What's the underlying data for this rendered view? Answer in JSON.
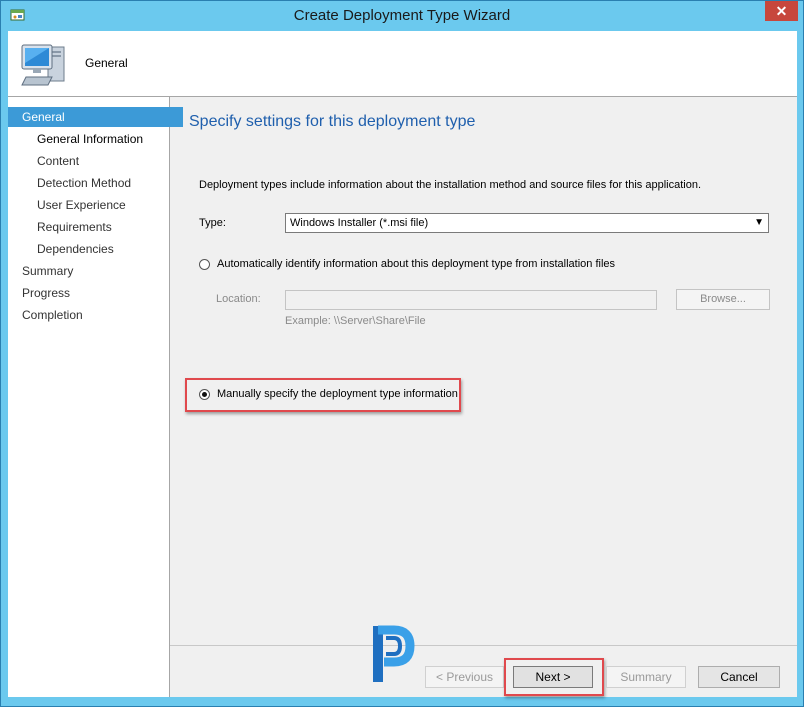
{
  "window": {
    "title": "Create Deployment Type Wizard",
    "close_glyph": "✕"
  },
  "header": {
    "title": "General"
  },
  "nav": {
    "items": [
      {
        "label": "General",
        "level": 0,
        "state": "active"
      },
      {
        "label": "General Information",
        "level": 1,
        "state": "current"
      },
      {
        "label": "Content",
        "level": 1,
        "state": "normal"
      },
      {
        "label": "Detection Method",
        "level": 1,
        "state": "normal"
      },
      {
        "label": "User Experience",
        "level": 1,
        "state": "normal"
      },
      {
        "label": "Requirements",
        "level": 1,
        "state": "normal"
      },
      {
        "label": "Dependencies",
        "level": 1,
        "state": "normal"
      },
      {
        "label": "Summary",
        "level": 0,
        "state": "normal"
      },
      {
        "label": "Progress",
        "level": 0,
        "state": "normal"
      },
      {
        "label": "Completion",
        "level": 0,
        "state": "normal"
      }
    ]
  },
  "content": {
    "heading": "Specify settings for this deployment type",
    "description": "Deployment types include information about the installation method and source files for this application.",
    "type_label": "Type:",
    "type_value": "Windows Installer (*.msi file)",
    "auto_option_label": "Automatically identify information about this deployment type from installation files",
    "auto_option_checked": false,
    "location_label": "Location:",
    "location_value": "",
    "browse_label": "Browse...",
    "example_text": "Example: \\\\Server\\Share\\File",
    "manual_option_label": "Manually specify the deployment type information",
    "manual_option_checked": true
  },
  "footer": {
    "previous_label": "< Previous",
    "next_label": "Next >",
    "summary_label": "Summary",
    "cancel_label": "Cancel"
  },
  "colors": {
    "titlebar": "#6bc9ee",
    "nav_active": "#3c9ad7",
    "heading": "#1f5fad",
    "highlight": "#e0494d",
    "close_button": "#c7473c"
  },
  "icons": [
    "wizard-app-icon",
    "computer-icon",
    "close-icon",
    "chevron-down-icon",
    "watermark-logo"
  ]
}
